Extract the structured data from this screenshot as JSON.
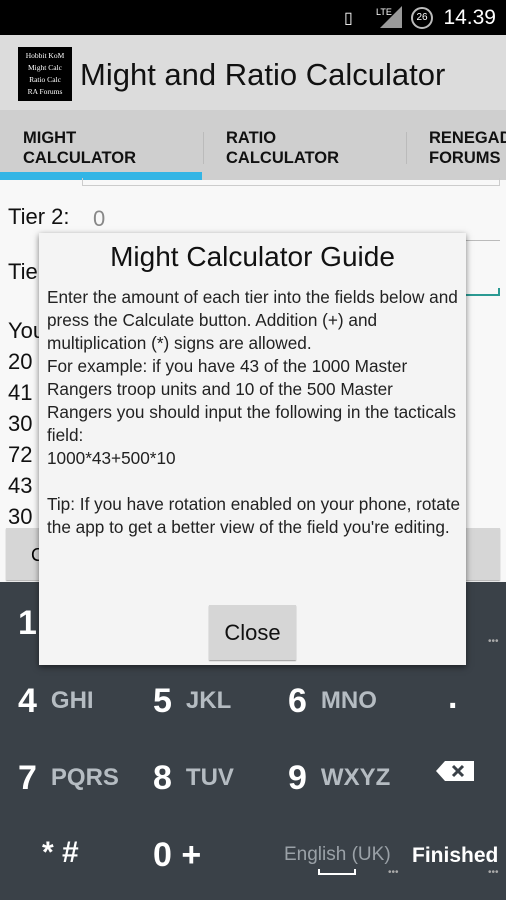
{
  "status": {
    "time": "14.39",
    "battery": "26",
    "network": "LTE",
    "icons": [
      "vibrate-icon",
      "lte-signal-icon",
      "battery-icon"
    ]
  },
  "app": {
    "title": "Might and Ratio Calculator",
    "logo_lines": [
      "Hobbit KoM",
      "Might Calc",
      "Ratio Calc",
      "RA Forums"
    ]
  },
  "tabs": [
    {
      "label": "MIGHT\nCALCULATOR",
      "selected": true
    },
    {
      "label": "RATIO\nCALCULATOR"
    },
    {
      "label": "RENEGADE\nFORUMS"
    }
  ],
  "accent": "#33b5e5",
  "form": {
    "tier2_label": "Tier 2:",
    "tier2_value": "0",
    "tier3_label": "Tie",
    "results": [
      "You",
      "20",
      "41",
      "30",
      "72",
      "43",
      "30"
    ],
    "button": "C"
  },
  "dialog": {
    "title": "Might Calculator Guide",
    "body": "Enter the amount of each tier into the fields below and press the Calculate button. Addition (+) and multiplication (*) signs are allowed.\nFor example: if you have 43 of the 1000 Master Rangers troop units and 10 of the 500 Master Rangers you should input the following in the tacticals field:\n1000*43+500*10\n\nTip: If you have rotation enabled on your phone, rotate the app to get a better view of the field you're editing.",
    "close": "Close"
  },
  "keyboard": {
    "k1": "1",
    "k4": "4",
    "s4": "GHI",
    "k5": "5",
    "s5": "JKL",
    "k6": "6",
    "s6": "MNO",
    "dot": ".",
    "k7": "7",
    "s7": "PQRS",
    "k8": "8",
    "s8": "TUV",
    "k9": "9",
    "s9": "WXYZ",
    "star": "* #",
    "k0": "0 +",
    "lang": "English (UK)",
    "finished": "Finished"
  }
}
